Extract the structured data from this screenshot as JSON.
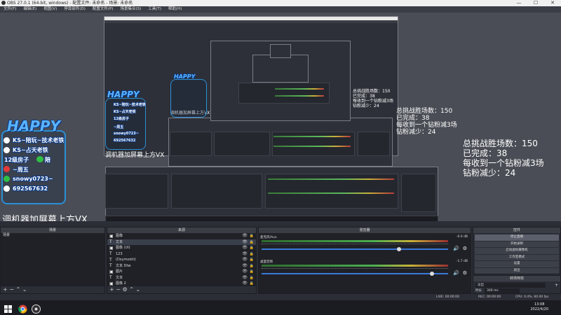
{
  "window": {
    "title": "OBS 27.0.1 (64-bit, windows) - 配置文件: 未命名 - 场景: 未命名",
    "controls": [
      "—",
      "☐",
      "✕"
    ]
  },
  "menu": [
    "文件(F)",
    "编辑(E)",
    "视图(V)",
    "停靠部件(D)",
    "配置文件(P)",
    "场景集合(S)",
    "工具(T)",
    "帮助(H)"
  ],
  "overlay": {
    "stats": [
      "总挑战胜场数：150",
      "已完成：38",
      "每收到一个钻粉减3场",
      "钻粉减少：24"
    ],
    "title": "调机器加屏幕上方VX",
    "happy_logo": "HAPPY",
    "happy_lines": [
      "KS~陪玩~技术老铁",
      "KS~占天老铁",
      "12级房子",
      "陪",
      "~周五",
      "snowy0723~",
      "692567632"
    ]
  },
  "docks": {
    "scenes": {
      "title": "场景",
      "items": [
        "场景"
      ]
    },
    "sources": {
      "title": "来源",
      "items": [
        {
          "icon": "image-icon",
          "label": "图像"
        },
        {
          "icon": "text-icon",
          "label": "文本"
        },
        {
          "icon": "image-icon",
          "label": "图像 (UI)"
        },
        {
          "icon": "text-icon",
          "label": "123"
        },
        {
          "icon": "text-icon",
          "label": "(Dxymoshi)"
        },
        {
          "icon": "text-icon",
          "label": "文本 Dtw"
        },
        {
          "icon": "image-icon",
          "label": "图片"
        },
        {
          "icon": "text-icon",
          "label": "文本"
        },
        {
          "icon": "image-icon",
          "label": "图像 2"
        },
        {
          "icon": "image-icon",
          "label": "图像"
        }
      ]
    },
    "mixer": {
      "title": "混音器",
      "channels": [
        {
          "name": "麦克风/Aux",
          "db": "-0.0 dB"
        },
        {
          "name": "桌面音频",
          "db": "-1.7 dB"
        }
      ]
    },
    "controls": {
      "title": "控件",
      "buttons": [
        "停止直播",
        "开始录制",
        "启动虚拟摄像机",
        "工作室模式",
        "设置",
        "退出"
      ]
    },
    "transitions": {
      "title": "转场特效",
      "type": "淡出",
      "duration_label": "时长",
      "duration": "300 ms"
    }
  },
  "status": {
    "live": "LIVE: 00:00:00",
    "rec": "REC: 00:00:00",
    "cpu": "CPU: 0.4%, 60.00 fps"
  },
  "taskbar": {
    "time": "13:08",
    "date": "2022/4/20"
  },
  "colors": {
    "accent": "#2a8fd6",
    "meter_green": "#4caf50",
    "meter_red": "#b83a3a",
    "slider": "#3a78d8"
  }
}
